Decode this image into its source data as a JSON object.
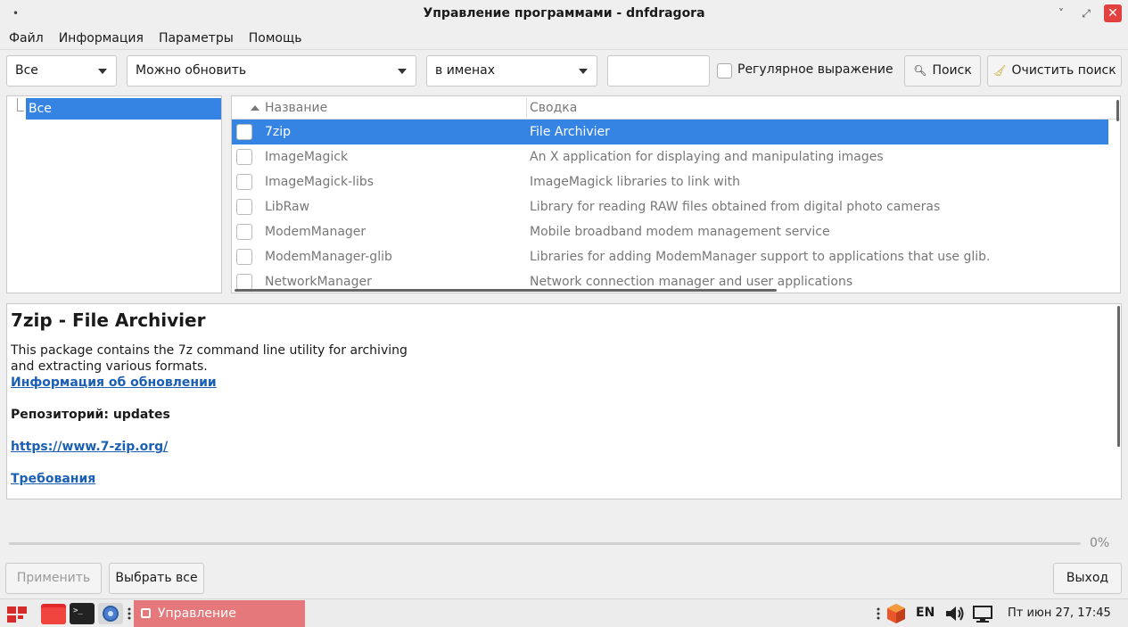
{
  "window": {
    "title": "Управление программами - dnfdragora"
  },
  "menu": [
    "Файл",
    "Информация",
    "Параметры",
    "Помощь"
  ],
  "toolbar": {
    "group_filter": "Все",
    "status_filter": "Можно обновить",
    "search_scope": "в именах",
    "search_value": "",
    "regex_label": "Регулярное выражение",
    "search_button": "Поиск",
    "clear_button": "Очистить поиск"
  },
  "tree": {
    "selected": "Все"
  },
  "table": {
    "col_name": "Название",
    "col_summary": "Сводка",
    "rows": [
      {
        "name": "7zip",
        "summary": "File Archivier",
        "selected": true
      },
      {
        "name": "ImageMagick",
        "summary": "An X application for displaying and manipulating images"
      },
      {
        "name": "ImageMagick-libs",
        "summary": "ImageMagick libraries to link with"
      },
      {
        "name": "LibRaw",
        "summary": "Library for reading RAW files obtained from digital photo cameras"
      },
      {
        "name": "ModemManager",
        "summary": "Mobile broadband modem management service"
      },
      {
        "name": "ModemManager-glib",
        "summary": "Libraries for adding ModemManager support to applications that use glib."
      },
      {
        "name": "NetworkManager",
        "summary": "Network connection manager and user applications"
      }
    ]
  },
  "details": {
    "heading": "7zip - File Archivier",
    "description": "This package contains the 7z command line utility for archiving and extracting various formats.",
    "update_info_link": "Информация об обновлении",
    "repository": "Репозиторий: updates",
    "url": "https://www.7-zip.org/",
    "requirements_link": "Требования"
  },
  "progress": {
    "value": 0,
    "label": "0%"
  },
  "buttons": {
    "apply": "Применить",
    "select_all": "Выбрать все",
    "exit": "Выход"
  },
  "taskbar": {
    "window_label": "Управление программ...",
    "language": "EN",
    "clock": "Пт июн 27, 17:45"
  },
  "colors": {
    "accent": "#3584e4",
    "link": "#1a5fb4",
    "close": "#e0403f",
    "task_active": "#e5787a"
  }
}
